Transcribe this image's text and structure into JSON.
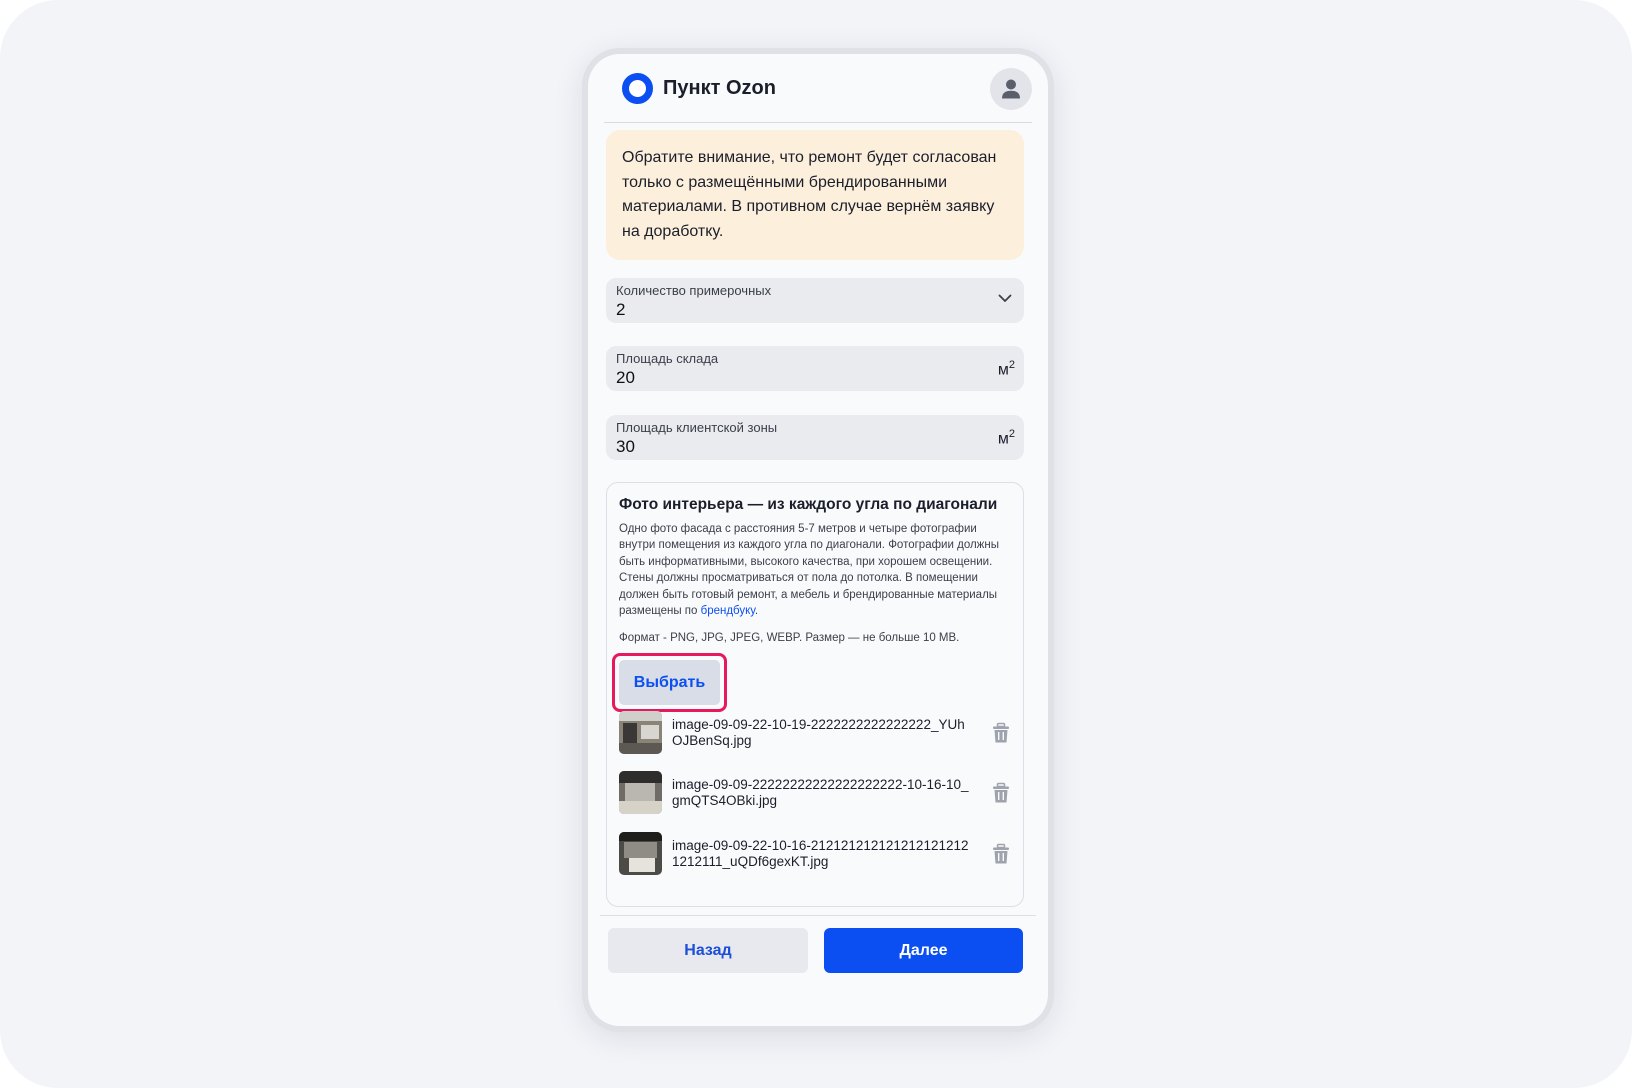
{
  "header": {
    "title": "Пункт Ozon",
    "brand_color": "#0b4ff2",
    "logo_icon": "ozon-ring-logo",
    "profile_icon": "user-icon"
  },
  "notice": {
    "text": "Обратите внимание, что ремонт будет согласован только с размещёнными брендированными материалами. В противном случае вернём заявку на доработку."
  },
  "fields": {
    "fitting_rooms": {
      "label": "Количество примерочных",
      "value": "2"
    },
    "warehouse_area": {
      "label": "Площадь склада",
      "value": "20",
      "unit": "м",
      "unit_sup": "2"
    },
    "client_area": {
      "label": "Площадь клиентской зоны",
      "value": "30",
      "unit": "м",
      "unit_sup": "2"
    }
  },
  "upload": {
    "title": "Фото интерьера — из каждого угла по диагонали",
    "description": "Одно фото фасада с расстояния 5-7 метров и четыре фотографии внутри помещения из каждого угла по диагонали. Фотографии должны быть информативными, высокого качества, при хорошем освещении. Стены должны просматриваться от пола до потолка. В помещении должен быть готовый ремонт, а мебель и брендированные материалы размещены по ",
    "brandbook_link": "брендбуку",
    "description_end": ".",
    "format": "Формат - PNG, JPG, JPEG, WEBP. Размер — не больше 10 MB.",
    "choose_label": "Выбрать",
    "highlight_color": "#e5195c",
    "files": [
      {
        "name": "image-09-09-22-10-19-2222222222222222_YUhOJBenSq.jpg"
      },
      {
        "name": "image-09-09-22222222222222222222-10-16-10_gmQTS4OBki.jpg"
      },
      {
        "name": "image-09-09-22-10-16-2121212121212121212121212111_uQDf6gexKT.jpg"
      }
    ]
  },
  "footer": {
    "back_label": "Назад",
    "next_label": "Далее"
  }
}
